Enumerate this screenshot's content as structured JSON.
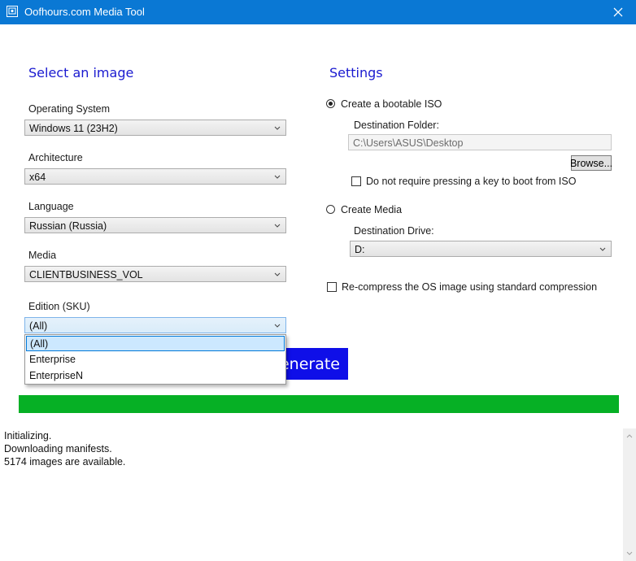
{
  "window": {
    "title": "Oofhours.com Media Tool"
  },
  "left": {
    "heading": "Select an image",
    "fields": [
      {
        "label": "Operating System",
        "value": "Windows 11 (23H2)"
      },
      {
        "label": "Architecture",
        "value": "x64"
      },
      {
        "label": "Language",
        "value": "Russian (Russia)"
      },
      {
        "label": "Media",
        "value": "CLIENTBUSINESS_VOL"
      },
      {
        "label": "Edition (SKU)",
        "value": "(All)"
      }
    ],
    "edition_options": [
      "(All)",
      "Enterprise",
      "EnterpriseN"
    ]
  },
  "settings": {
    "heading": "Settings",
    "iso_option": "Create a bootable ISO",
    "destination_folder_label": "Destination Folder:",
    "destination_folder_value": "C:\\Users\\ASUS\\Desktop",
    "browse_label": "Browse...",
    "no_key_label": "Do not require pressing a key to boot from ISO",
    "media_option": "Create Media",
    "destination_drive_label": "Destination Drive:",
    "destination_drive_value": "D:",
    "recompress_label": "Re-compress the OS image using standard compression"
  },
  "generate_label": "Generate",
  "progress": {
    "percent": 100,
    "color": "#06b025"
  },
  "log": [
    "Initializing.",
    "Downloading manifests.",
    "5174 images are available."
  ],
  "colors": {
    "titlebar": "#0a78d4",
    "heading": "#1a1ad0",
    "generate": "#0f0fe8"
  },
  "icons": {
    "app": "app-icon",
    "close": "close-icon",
    "dropdown": "chevron-down-icon"
  }
}
